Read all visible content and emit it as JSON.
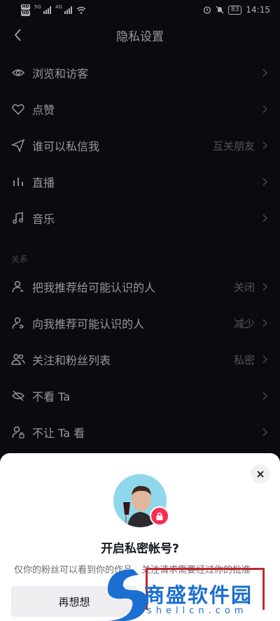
{
  "status_bar": {
    "sim1": "HD 1",
    "sim2": "HD 2",
    "net1": "5G",
    "net2": "4G",
    "battery": "83",
    "time": "14:15"
  },
  "header": {
    "title": "隐私设置"
  },
  "rows": [
    {
      "label": "浏览和访客",
      "value": "",
      "icon": "eye-icon"
    },
    {
      "label": "点赞",
      "value": "",
      "icon": "heart-icon"
    },
    {
      "label": "谁可以私信我",
      "value": "互关朋友",
      "icon": "send-icon"
    },
    {
      "label": "直播",
      "value": "",
      "icon": "live-icon"
    },
    {
      "label": "音乐",
      "value": "",
      "icon": "music-icon"
    }
  ],
  "section_relation": "关系",
  "relation_rows": [
    {
      "label": "把我推荐给可能认识的人",
      "value": "关闭",
      "icon": "user-recommend-icon"
    },
    {
      "label": "向我推荐可能认识的人",
      "value": "减少",
      "icon": "user-suggest-icon"
    },
    {
      "label": "关注和粉丝列表",
      "value": "私密",
      "icon": "users-icon"
    },
    {
      "label": "不看 Ta",
      "value": "",
      "icon": "eye-off-icon"
    },
    {
      "label": "不让 Ta 看",
      "value": "",
      "icon": "user-lock-icon"
    }
  ],
  "sheet": {
    "title": "开启私密帐号?",
    "description": "仅你的粉丝可以看到你的作品。关注请求需要经过你的批准",
    "later_button": "再想想"
  },
  "watermark": {
    "text": "商盛软件园",
    "url": "shellcn.com"
  },
  "colors": {
    "background": "#0f0f14",
    "accent": "#fe2c55",
    "watermark": "#1b6fd1"
  }
}
